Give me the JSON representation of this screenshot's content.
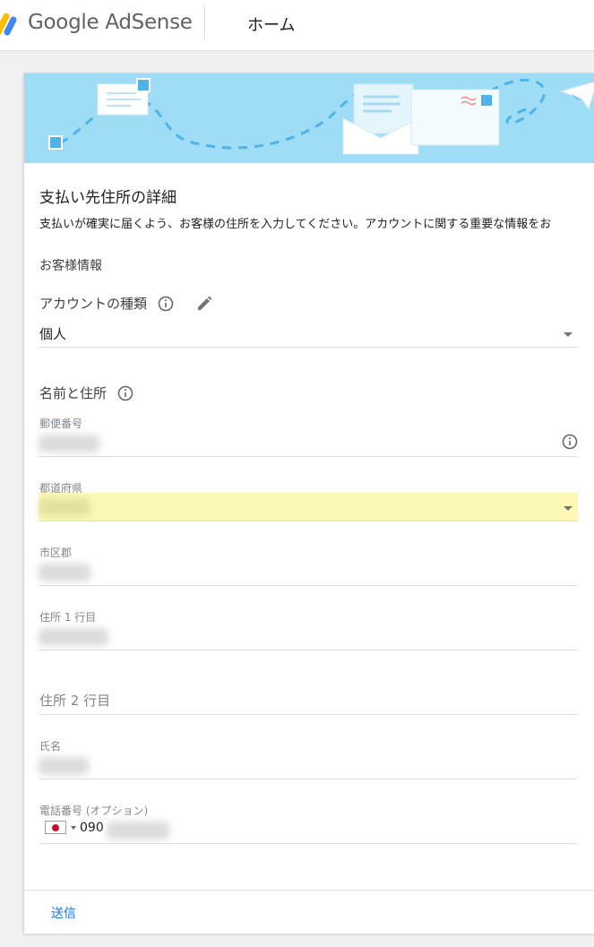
{
  "header": {
    "logo_text": "Google AdSense",
    "nav_home": "ホーム"
  },
  "form": {
    "title": "支払い先住所の詳細",
    "description": "支払いが確実に届くよう、お客様の住所を入力してください。アカウントに関する重要な情報をお",
    "section_customer_info": "お客様情報",
    "account_type_label": "アカウントの種類",
    "account_type_value": "個人",
    "name_address_label": "名前と住所",
    "postal_code_label": "郵便番号",
    "prefecture_label": "都道府県",
    "city_label": "市区郡",
    "address_line1_label": "住所 1 行目",
    "address_line2_placeholder": "住所 2 行目",
    "full_name_label": "氏名",
    "phone_label": "電話番号 (オプション)",
    "phone_value_prefix": "090",
    "submit_label": "送信"
  },
  "colors": {
    "accent": "#1a73e8",
    "banner": "#9fdcf6",
    "highlight": "#fcf9b6"
  },
  "icons": {
    "logo": "adsense-logo-icon",
    "info": "info-icon",
    "edit": "pencil-icon",
    "dropdown": "caret-down-icon",
    "flag": "japan-flag-icon"
  }
}
